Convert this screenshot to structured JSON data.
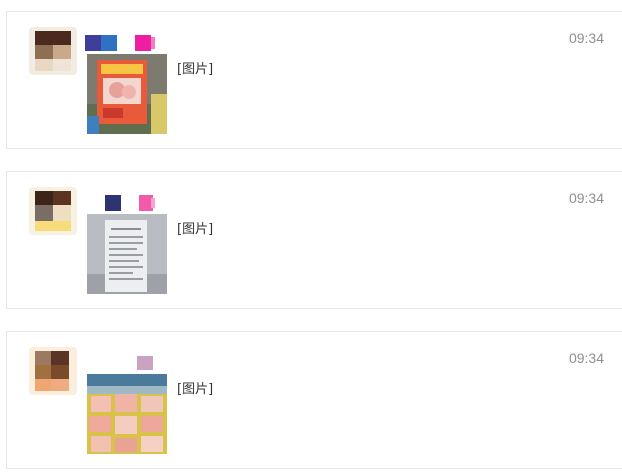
{
  "messages": [
    {
      "time": "09:34",
      "content": "[图片]",
      "avatar_icon": "blurred-avatar",
      "image_icon": "price-sign-photo"
    },
    {
      "time": "09:34",
      "content": "[图片]",
      "avatar_icon": "blurred-avatar",
      "image_icon": "receipt-photo"
    },
    {
      "time": "09:34",
      "content": "[图片]",
      "avatar_icon": "blurred-avatar",
      "image_icon": "food-display-photo"
    }
  ],
  "colors": {
    "border": "#e6e6e6",
    "timestamp": "#8f8f8f",
    "text": "#333333"
  }
}
